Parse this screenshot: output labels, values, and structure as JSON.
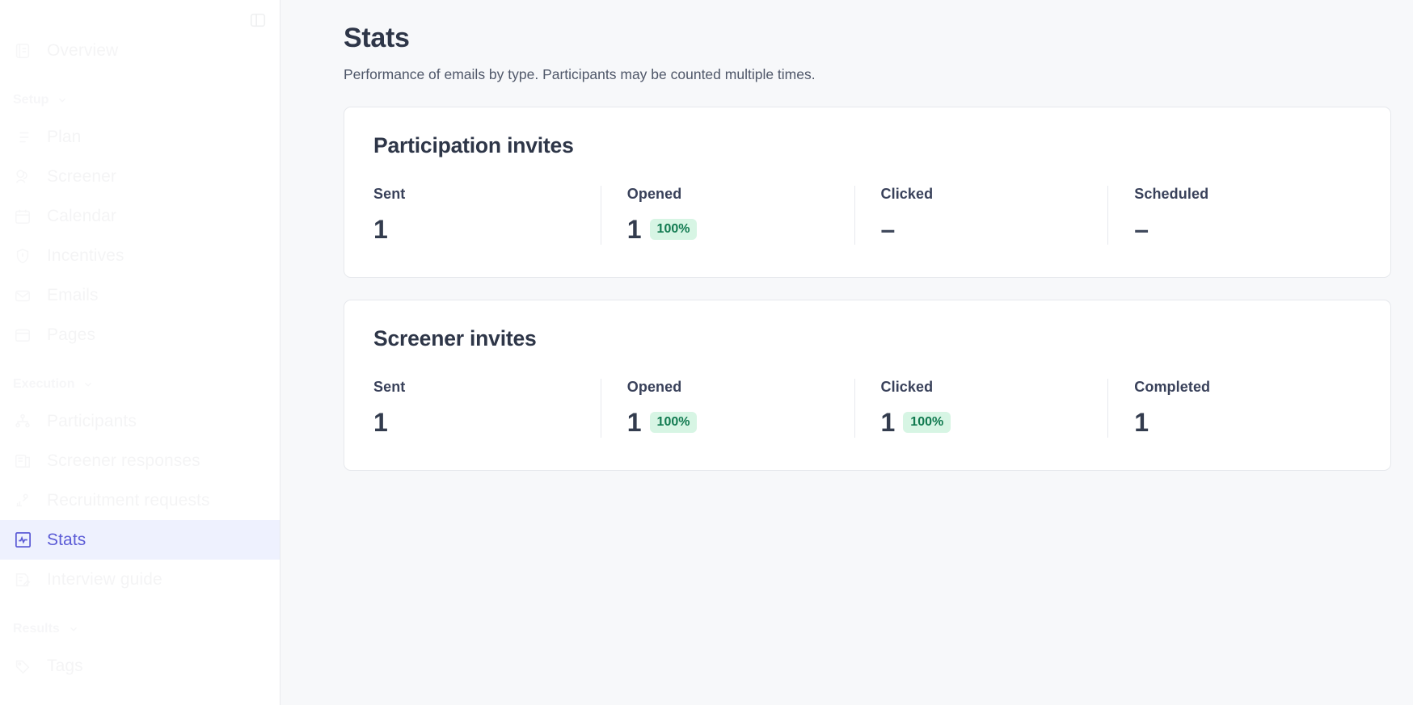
{
  "sidebar": {
    "toggle_icon": "panel-toggle-icon",
    "items": [
      {
        "label": "Overview",
        "icon": "overview-icon",
        "type": "item",
        "active": false
      },
      {
        "label": "Setup",
        "icon": "chevron-down-icon",
        "type": "section"
      },
      {
        "label": "Plan",
        "icon": "plan-icon",
        "type": "item",
        "active": false
      },
      {
        "label": "Screener",
        "icon": "screener-icon",
        "type": "item",
        "active": false
      },
      {
        "label": "Calendar",
        "icon": "calendar-icon",
        "type": "item",
        "active": false
      },
      {
        "label": "Incentives",
        "icon": "incentives-icon",
        "type": "item",
        "active": false
      },
      {
        "label": "Emails",
        "icon": "emails-icon",
        "type": "item",
        "active": false
      },
      {
        "label": "Pages",
        "icon": "pages-icon",
        "type": "item",
        "active": false
      },
      {
        "label": "Execution",
        "icon": "chevron-down-icon",
        "type": "section"
      },
      {
        "label": "Participants",
        "icon": "participants-icon",
        "type": "item",
        "active": false
      },
      {
        "label": "Screener responses",
        "icon": "screener-responses-icon",
        "type": "item",
        "active": false
      },
      {
        "label": "Recruitment requests",
        "icon": "recruitment-requests-icon",
        "type": "item",
        "active": false
      },
      {
        "label": "Stats",
        "icon": "stats-icon",
        "type": "item",
        "active": true
      },
      {
        "label": "Interview guide",
        "icon": "interview-guide-icon",
        "type": "item",
        "active": false
      },
      {
        "label": "Results",
        "icon": "chevron-down-icon",
        "type": "section"
      },
      {
        "label": "Tags",
        "icon": "tags-icon",
        "type": "item",
        "active": false
      }
    ]
  },
  "page": {
    "title": "Stats",
    "subtitle": "Performance of emails by type. Participants may be counted multiple times."
  },
  "cards": [
    {
      "title": "Participation invites",
      "metrics": [
        {
          "label": "Sent",
          "value": "1",
          "badge": ""
        },
        {
          "label": "Opened",
          "value": "1",
          "badge": "100%"
        },
        {
          "label": "Clicked",
          "value": "–",
          "badge": ""
        },
        {
          "label": "Scheduled",
          "value": "–",
          "badge": ""
        }
      ]
    },
    {
      "title": "Screener invites",
      "metrics": [
        {
          "label": "Sent",
          "value": "1",
          "badge": ""
        },
        {
          "label": "Opened",
          "value": "1",
          "badge": "100%"
        },
        {
          "label": "Clicked",
          "value": "1",
          "badge": "100%"
        },
        {
          "label": "Completed",
          "value": "1",
          "badge": ""
        }
      ]
    }
  ],
  "colors": {
    "accent": "#5b5bd6",
    "active_bg": "#eef1fe",
    "badge_bg": "#d7f5e4",
    "badge_text": "#117a50",
    "page_bg": "#f7f8fa",
    "card_bg": "#ffffff",
    "card_border": "#e6e8ec",
    "heading": "#2e3648"
  }
}
